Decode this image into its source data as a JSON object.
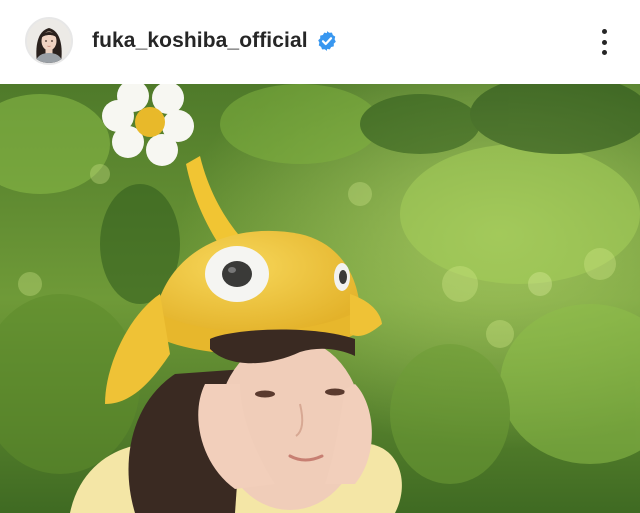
{
  "post": {
    "username": "fuka_koshiba_official",
    "verified": true,
    "verified_badge_color": "#3897f0",
    "more_icon": "more-vertical-icon",
    "avatar_icon": "profile-avatar",
    "image_description_icon": "post-photo"
  },
  "colors": {
    "header_bg": "#ffffff",
    "username_text": "#262626",
    "foliage_dark": "#2f5a1c",
    "foliage_light": "#8fbf4a",
    "hat_yellow": "#f2c531"
  }
}
